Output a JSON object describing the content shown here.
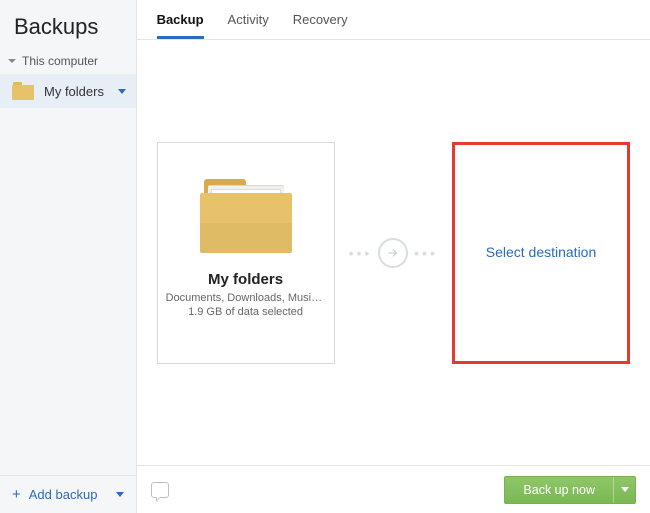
{
  "sidebar": {
    "title": "Backups",
    "group_label": "This computer",
    "item": {
      "label": "My folders"
    },
    "add_label": "Add backup"
  },
  "tabs": [
    {
      "label": "Backup",
      "active": true
    },
    {
      "label": "Activity",
      "active": false
    },
    {
      "label": "Recovery",
      "active": false
    }
  ],
  "source_card": {
    "title": "My folders",
    "description": "Documents, Downloads, Music, Pi…",
    "subtitle": "1.9 GB of data selected"
  },
  "destination_card": {
    "label": "Select destination"
  },
  "actions": {
    "backup_now": "Back up now"
  }
}
